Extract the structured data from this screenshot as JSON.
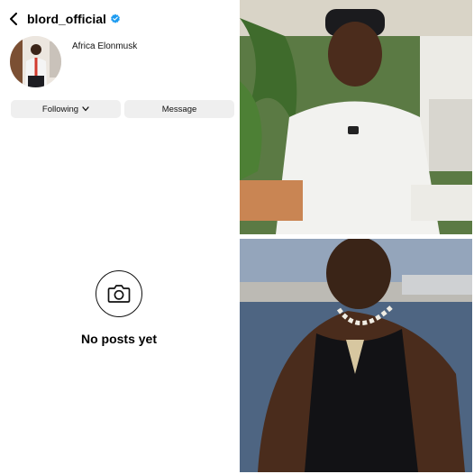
{
  "profile": {
    "username": "blord_official",
    "display_name": "Africa Elonmusk",
    "verified": true,
    "verified_color": "#1d9bf0"
  },
  "actions": {
    "following_label": "Following",
    "message_label": "Message"
  },
  "posts": {
    "empty_label": "No posts yet"
  },
  "icons": {
    "back": "chevron-left-icon",
    "verified": "verified-badge-icon",
    "following_dropdown": "chevron-down-icon",
    "empty_state": "camera-icon"
  }
}
